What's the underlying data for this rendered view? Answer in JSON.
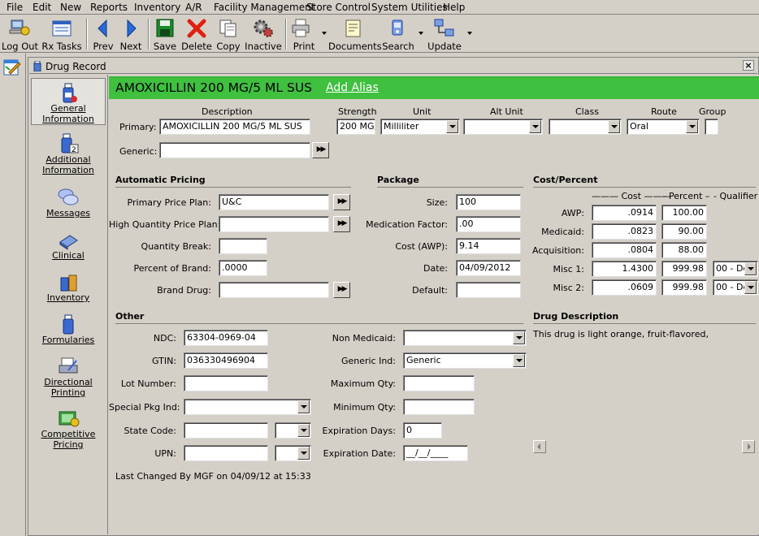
{
  "menu": [
    "File",
    "Edit",
    "New",
    "Reports",
    "Inventory",
    "A/R",
    "Facility Management",
    "Store Control",
    "System Utilities",
    "Help"
  ],
  "toolbar": {
    "logout": "Log Out",
    "rxtasks": "Rx Tasks",
    "prev": "Prev",
    "next": "Next",
    "save": "Save",
    "delete": "Delete",
    "copy": "Copy",
    "inactive": "Inactive",
    "print": "Print",
    "documents": "Documents",
    "search": "Search",
    "update": "Update"
  },
  "window": {
    "title": "Drug Record",
    "close": "×"
  },
  "nav": {
    "general_1": "General",
    "general_2": "Information",
    "additional_1": "Additional",
    "additional_2": "Information",
    "messages": "Messages",
    "clinical": "Clinical",
    "inventory": "Inventory",
    "formularies": "Formularies",
    "directional_1": "Directional",
    "directional_2": "Printing",
    "competitive_1": "Competitive",
    "competitive_2": "Pricing"
  },
  "header": {
    "drug_name": "AMOXICILLIN 200 MG/5 ML SUS",
    "add_alias": "Add Alias"
  },
  "primary_row": {
    "col_description": "Description",
    "col_strength": "Strength",
    "col_unit": "Unit",
    "col_alt_unit": "Alt Unit",
    "col_class": "Class",
    "col_route": "Route",
    "col_group": "Group",
    "primary_label": "Primary:",
    "description": "AMOXICILLIN 200 MG/5 ML SUS",
    "strength": "200 MG/",
    "unit": "Milliliter",
    "alt_unit": "",
    "class": "",
    "route": "Oral",
    "group": "",
    "generic_label": "Generic:",
    "generic": ""
  },
  "automatic_pricing": {
    "title": "Automatic Pricing",
    "primary_price_plan_label": "Primary Price Plan:",
    "primary_price_plan": "U&C",
    "high_qty_plan_label": "High Quantity Price Plan:",
    "high_qty_plan": "",
    "quantity_break_label": "Quantity Break:",
    "quantity_break": "",
    "percent_of_brand_label": "Percent of Brand:",
    "percent_of_brand": ".0000",
    "brand_drug_label": "Brand Drug:",
    "brand_drug": ""
  },
  "package": {
    "title": "Package",
    "size_label": "Size:",
    "size": "100",
    "med_factor_label": "Medication Factor:",
    "med_factor": ".00",
    "cost_label": "Cost (AWP):",
    "cost": "9.14",
    "date_label": "Date:",
    "date": "04/09/2012",
    "default_label": "Default:",
    "default": ""
  },
  "cost_percent": {
    "title": "Cost/Percent",
    "col_cost": "——— Cost ———",
    "col_percent": "– Percent –",
    "col_qualifier": "- Qualifier -",
    "rows": [
      {
        "label": "AWP:",
        "cost": ".0914",
        "percent": "100.00",
        "qualifier": ""
      },
      {
        "label": "Medicaid:",
        "cost": ".0823",
        "percent": "90.00",
        "qualifier": ""
      },
      {
        "label": "Acquisition:",
        "cost": ".0804",
        "percent": "88.00",
        "qualifier": ""
      },
      {
        "label": "Misc 1:",
        "cost": "1.4300",
        "percent": "999.98",
        "qualifier": "00 - De"
      },
      {
        "label": "Misc 2:",
        "cost": ".0609",
        "percent": "999.98",
        "qualifier": "00 - De"
      }
    ]
  },
  "other": {
    "title": "Other",
    "ndc_label": "NDC:",
    "ndc": "63304-0969-04",
    "gtin_label": "GTIN:",
    "gtin": "036330496904",
    "lot_label": "Lot Number:",
    "lot": "",
    "special_pkg_label": "Special Pkg Ind:",
    "special_pkg": "",
    "state_code_label": "State Code:",
    "state_code": "",
    "upn_label": "UPN:",
    "upn": "",
    "non_medicaid_label": "Non Medicaid:",
    "non_medicaid": "",
    "generic_ind_label": "Generic Ind:",
    "generic_ind": "Generic",
    "max_qty_label": "Maximum Qty:",
    "max_qty": "",
    "min_qty_label": "Minimum Qty:",
    "min_qty": "",
    "exp_days_label": "Expiration Days:",
    "exp_days": "0",
    "exp_date_label": "Expiration Date:",
    "exp_date": "__/__/____",
    "last_changed": "Last Changed By MGF on 04/09/12 at 15:33"
  },
  "drug_description": {
    "title": "Drug Description",
    "text": "This drug is light orange, fruit-flavored,"
  }
}
